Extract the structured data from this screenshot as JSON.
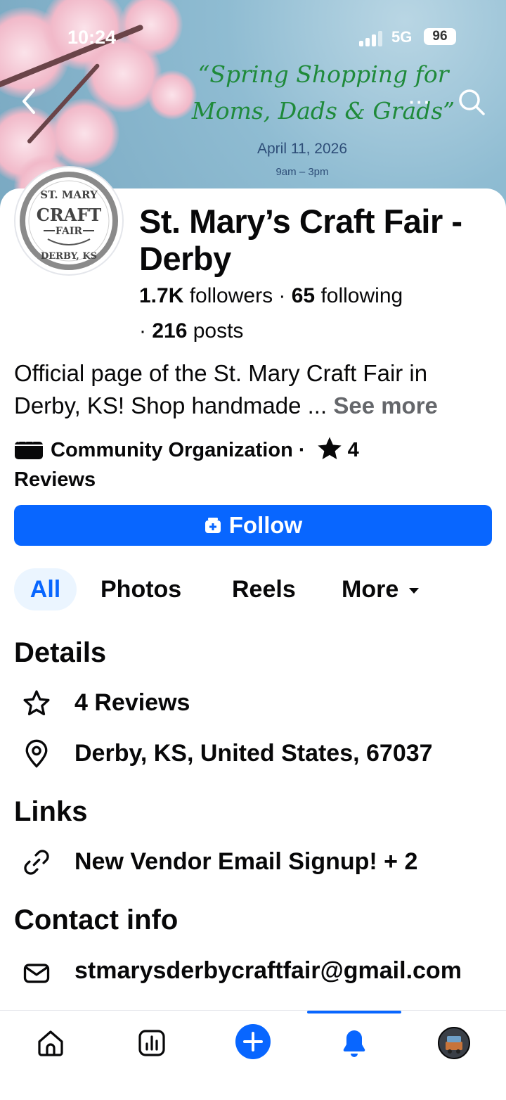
{
  "status_bar": {
    "time": "10:24",
    "network": "5G",
    "battery": "96"
  },
  "cover": {
    "headline_line1": "“Spring Shopping for",
    "headline_line2": "Moms, Dads & Grads”",
    "date": "April 11, 2026",
    "hours": "9am – 3pm",
    "more_label": "···"
  },
  "profile": {
    "logo_text_top": "ST. MARY",
    "logo_text_main": "CRAFT",
    "logo_text_sub": "FAIR",
    "logo_text_bottom": "DERBY, KS",
    "name": "St. Mary’s Craft Fair - Derby",
    "followers_count": "1.7K",
    "followers_label": " followers · ",
    "following_count": "65",
    "following_label": " following",
    "posts_prefix": "· ",
    "posts_count": "216",
    "posts_label": " posts",
    "bio": "Official page of the St. Mary Craft Fair in Derby, KS! Shop handmade ... ",
    "see_more": "See more",
    "category": "Community Organization",
    "category_sep": " · ",
    "rating": "4",
    "rating_suffix": "Reviews",
    "follow_label": "Follow"
  },
  "tabs": [
    {
      "label": "All",
      "selected": true
    },
    {
      "label": "Photos"
    },
    {
      "label": "Reels"
    },
    {
      "label": "More"
    }
  ],
  "details": {
    "heading": "Details",
    "reviews": "4 Reviews",
    "location": "Derby, KS, United States, 67037"
  },
  "links": {
    "heading": "Links",
    "item": "New Vendor Email Signup! + 2"
  },
  "contact": {
    "heading": "Contact info",
    "email": "stmarysderbycraftfair@gmail.com"
  },
  "colors": {
    "accent": "#0866ff",
    "text": "#080809",
    "secondary": "#65676b",
    "tab_bg": "#ebf5ff"
  },
  "bottom_nav": [
    {
      "icon": "home-icon"
    },
    {
      "icon": "dashboard-icon"
    },
    {
      "icon": "create-plus-icon"
    },
    {
      "icon": "notifications-bell-icon",
      "active": true
    },
    {
      "icon": "profile-avatar-icon"
    }
  ]
}
